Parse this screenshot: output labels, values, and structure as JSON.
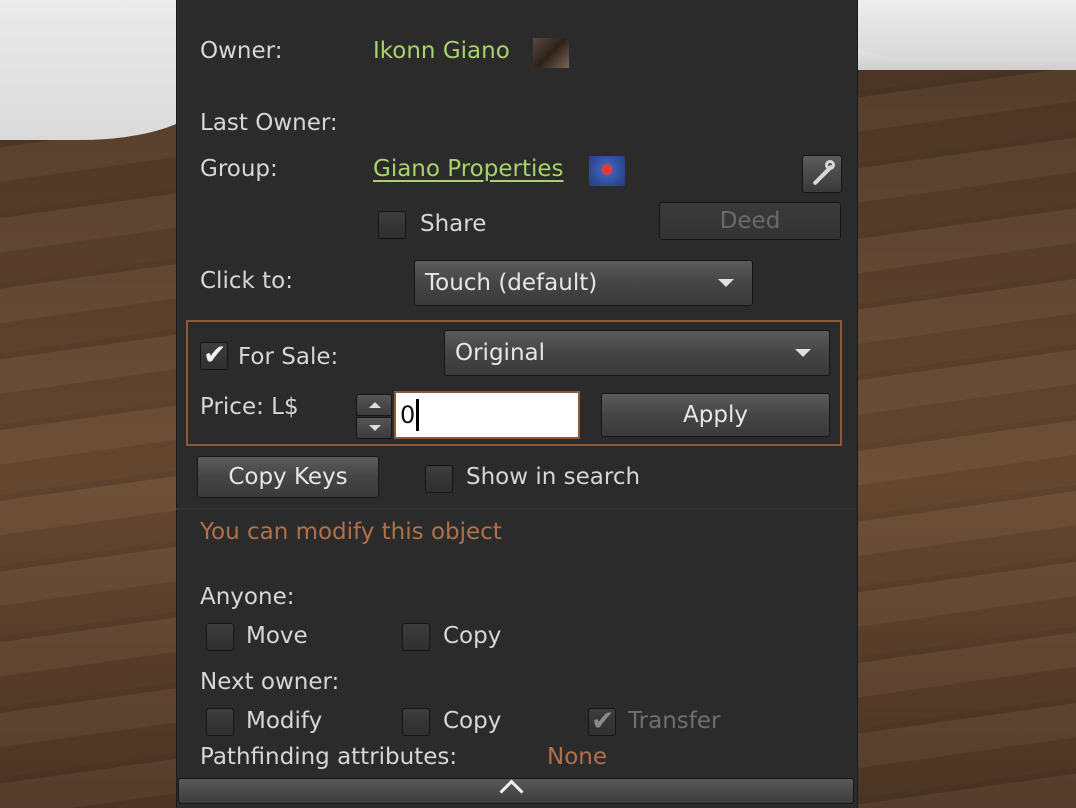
{
  "owner": {
    "label": "Owner:",
    "name": "Ikonn Giano",
    "thumb_icon": "avatar-thumbnail"
  },
  "last_owner": {
    "label": "Last Owner:",
    "name": ""
  },
  "group": {
    "label": "Group:",
    "name": "Giano Properties",
    "thumb_icon": "group-thumbnail",
    "edit_icon": "wrench-icon"
  },
  "share": {
    "label": "Share",
    "checked": false
  },
  "deed": {
    "label": "Deed",
    "enabled": false
  },
  "click_to": {
    "label": "Click to:",
    "value": "Touch  (default)"
  },
  "for_sale": {
    "label": "For Sale:",
    "checked": true,
    "sale_type": "Original"
  },
  "price": {
    "label": "Price: L$",
    "value": "0"
  },
  "apply": {
    "label": "Apply"
  },
  "copy_keys": {
    "label": "Copy Keys"
  },
  "show_in_search": {
    "label": "Show in search",
    "checked": false
  },
  "modify_status": "You can modify this object",
  "anyone": {
    "label": "Anyone:",
    "move": {
      "label": "Move",
      "checked": false
    },
    "copy": {
      "label": "Copy",
      "checked": false
    }
  },
  "next_owner": {
    "label": "Next owner:",
    "modify": {
      "label": "Modify",
      "checked": false
    },
    "copy": {
      "label": "Copy",
      "checked": false
    },
    "transfer": {
      "label": "Transfer",
      "checked": true,
      "enabled": false
    }
  },
  "pathfinding": {
    "label": "Pathfinding attributes:",
    "value": "None"
  },
  "colors": {
    "accent_green": "#a8d26a",
    "accent_orange": "#b0704a",
    "panel_bg": "#2b2b2b"
  }
}
